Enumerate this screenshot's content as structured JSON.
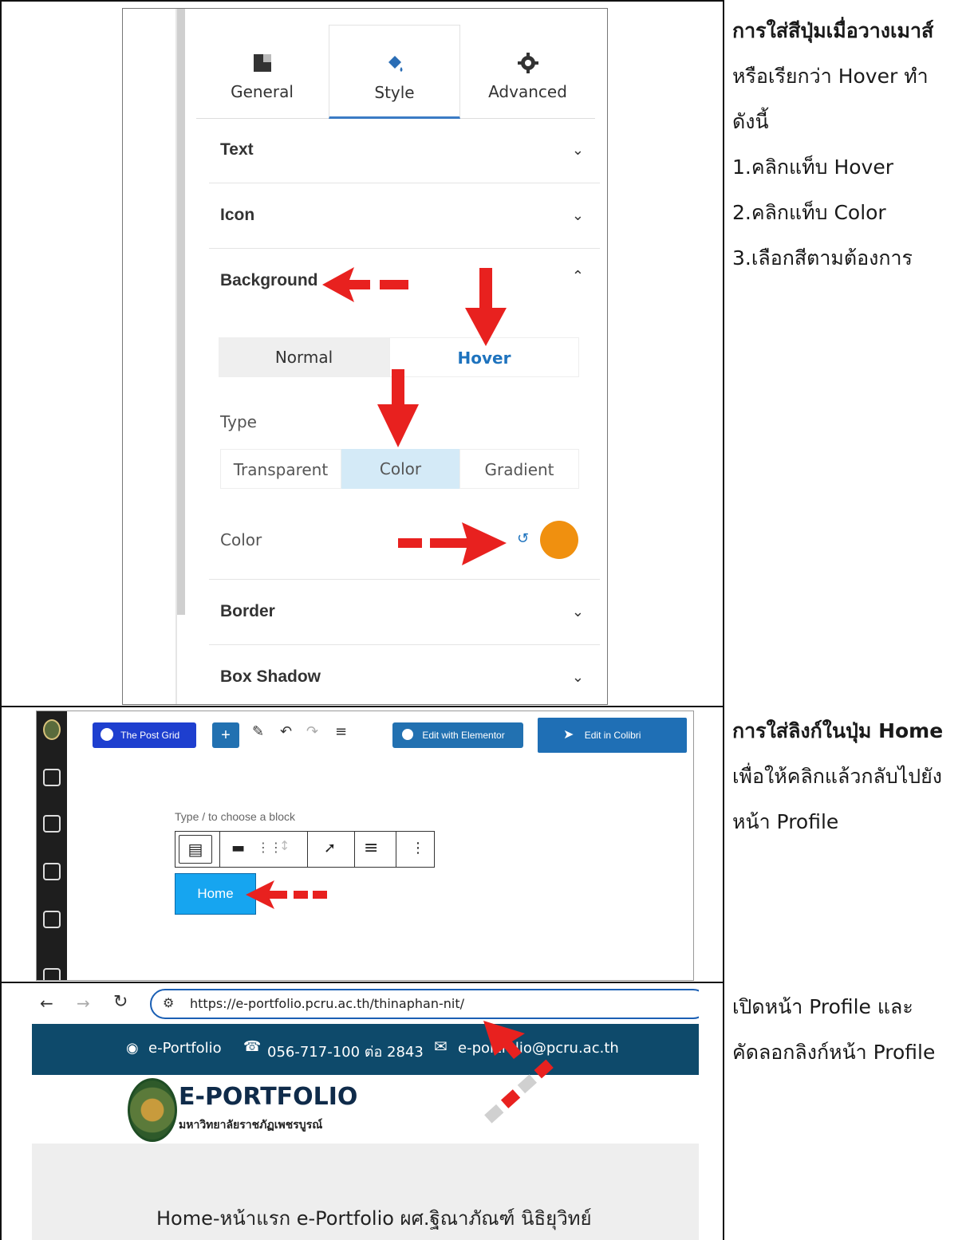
{
  "rows": [
    {
      "description": {
        "title": "การใส่สีปุ่มเมื่อวางเมาส์",
        "lines": [
          "หรือเรียกว่า Hover ทำ",
          "ดังนี้",
          "1.คลิกแท็บ Hover",
          "2.คลิกแท็บ Color",
          "3.เลือกสีตามต้องการ"
        ]
      }
    },
    {
      "description": {
        "title": "การใส่ลิงก์ในปุ่ม Home",
        "lines": [
          "เพื่อให้คลิกแล้วกลับไปยัง",
          "หน้า Profile"
        ]
      }
    },
    {
      "description": {
        "title": "",
        "lines": [
          "เปิดหน้า Profile และ",
          "คัดลอกลิงก์หน้า Profile"
        ]
      }
    }
  ],
  "style_panel": {
    "tabs": [
      {
        "label": "General",
        "icon": "layout-icon"
      },
      {
        "label": "Style",
        "icon": "paint-bucket-icon"
      },
      {
        "label": "Advanced",
        "icon": "gear-icon"
      }
    ],
    "sections": {
      "text": "Text",
      "icon": "Icon",
      "background": "Background",
      "border": "Border",
      "box_shadow": "Box Shadow"
    },
    "state_tabs": {
      "normal": "Normal",
      "hover": "Hover"
    },
    "type_label": "Type",
    "type_options": {
      "transparent": "Transparent",
      "color": "Color",
      "gradient": "Gradient"
    },
    "color_label": "Color",
    "selected_color": "#f0900f"
  },
  "block_editor": {
    "post_grid_label": "The Post Grid",
    "edit_elementor_label": "Edit with Elementor",
    "edit_colibri_label": "Edit in Colibri",
    "placeholder": "Type / to choose a block",
    "home_button_text": "Home"
  },
  "browser": {
    "url": "https://e-portfolio.pcru.ac.th/thinaphan-nit/",
    "topbar": {
      "site": "e-Portfolio",
      "phone": "056-717-100 ต่อ 2843",
      "email": "e-portfolio@pcru.ac.th"
    },
    "logo_title": "E-PORTFOLIO",
    "logo_subtitle": "มหาวิทยาลัยราชภัฏเพชรบูรณ์",
    "page_heading": "Home-หน้าแรก e-Portfolio ผศ.ฐิณาภัณฑ์ นิธิยุวิทย์"
  },
  "colors": {
    "accent_blue": "#1e73be",
    "arrow_red": "#e8211f",
    "site_navy": "#0e4a6b"
  }
}
